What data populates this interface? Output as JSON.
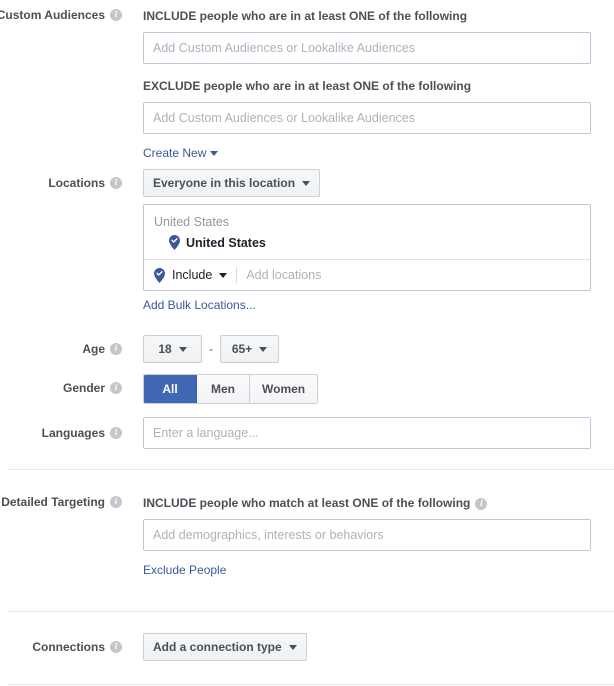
{
  "custom_audiences": {
    "label": "Custom Audiences",
    "include_heading": "INCLUDE people who are in at least ONE of the following",
    "include_placeholder": "Add Custom Audiences or Lookalike Audiences",
    "include_value": "",
    "exclude_heading": "EXCLUDE people who are in at least ONE of the following",
    "exclude_placeholder": "Add Custom Audiences or Lookalike Audiences",
    "exclude_value": "",
    "create_new_link": "Create New"
  },
  "locations": {
    "label": "Locations",
    "scope_selected": "Everyone in this location",
    "group_title": "United States",
    "selected_location": "United States",
    "include_mode": "Include",
    "add_locations_placeholder": "Add locations",
    "bulk_link": "Add Bulk Locations..."
  },
  "age": {
    "label": "Age",
    "min": "18",
    "separator": "-",
    "max": "65+"
  },
  "gender": {
    "label": "Gender",
    "options": [
      {
        "label": "All",
        "selected": true
      },
      {
        "label": "Men",
        "selected": false
      },
      {
        "label": "Women",
        "selected": false
      }
    ]
  },
  "languages": {
    "label": "Languages",
    "placeholder": "Enter a language...",
    "value": ""
  },
  "detailed_targeting": {
    "label": "Detailed Targeting",
    "include_heading": "INCLUDE people who match at least ONE of the following",
    "placeholder": "Add demographics, interests or behaviors",
    "value": "",
    "exclude_link": "Exclude People"
  },
  "connections": {
    "label": "Connections",
    "selected": "Add a connection type"
  },
  "colors": {
    "accent_blue": "#4267b2",
    "link_blue": "#3b5998",
    "label_grey": "#4b4f56",
    "placeholder_grey": "#adb2bb",
    "input_border": "#bdc7d8",
    "divider": "#e5e7ea"
  }
}
